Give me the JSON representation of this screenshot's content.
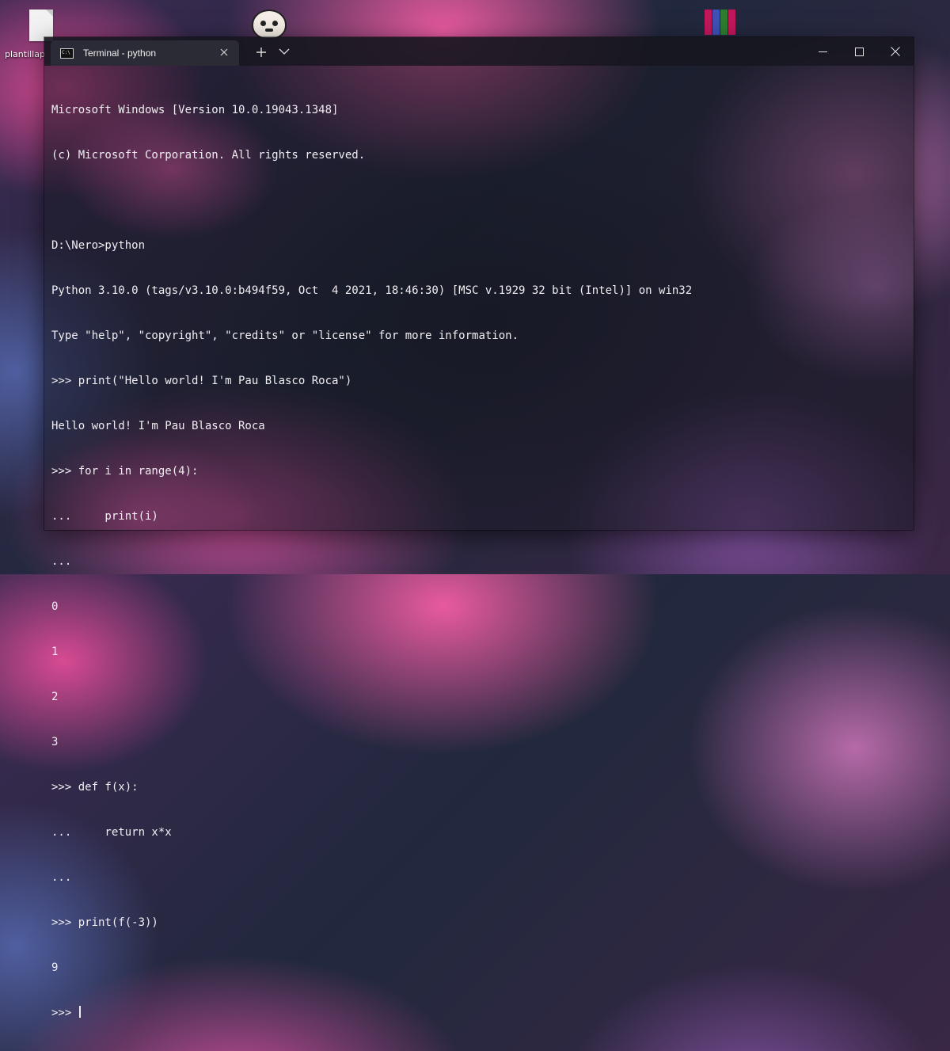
{
  "desktop": {
    "icons": [
      {
        "label": "plantillap",
        "icon": "file-icon"
      },
      {
        "label": "",
        "icon": "game-face-icon"
      },
      {
        "label": "",
        "icon": "winrar-icon"
      }
    ]
  },
  "window": {
    "tab_title": "Terminal - python",
    "tab_icon": "cmd-icon",
    "tab_icon_text": "C:\\",
    "buttons": [
      "new-tab",
      "dropdown",
      "minimize",
      "maximize",
      "close"
    ]
  },
  "terminal": {
    "lines": [
      "Microsoft Windows [Version 10.0.19043.1348]",
      "(c) Microsoft Corporation. All rights reserved.",
      "",
      "D:\\Nero>python",
      "Python 3.10.0 (tags/v3.10.0:b494f59, Oct  4 2021, 18:46:30) [MSC v.1929 32 bit (Intel)] on win32",
      "Type \"help\", \"copyright\", \"credits\" or \"license\" for more information.",
      ">>> print(\"Hello world! I'm Pau Blasco Roca\")",
      "Hello world! I'm Pau Blasco Roca",
      ">>> for i in range(4):",
      "...     print(i)",
      "...",
      "0",
      "1",
      "2",
      "3",
      ">>> def f(x):",
      "...     return x*x",
      "...",
      ">>> print(f(-3))",
      "9"
    ],
    "prompt": ">>> "
  },
  "colors": {
    "text": "#f0eef2",
    "titlebar": "#16161e",
    "tab": "#2c2c38"
  }
}
